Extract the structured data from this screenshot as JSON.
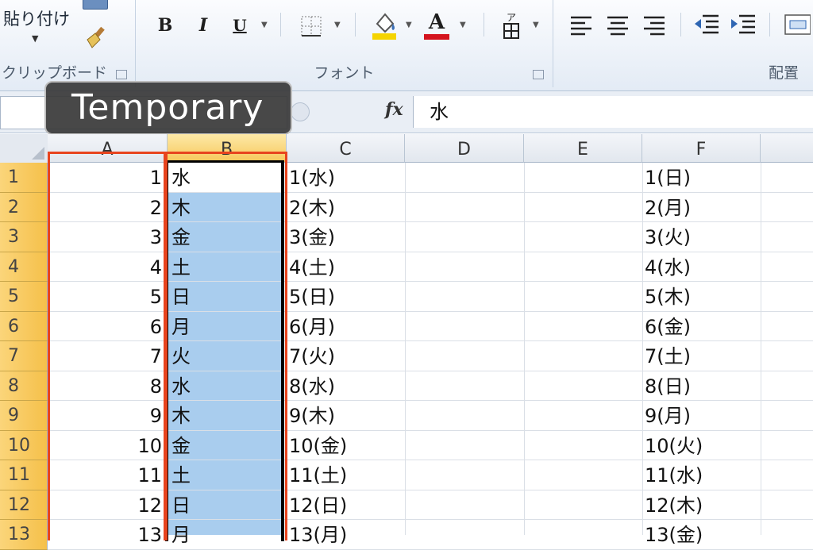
{
  "ribbon": {
    "paste_label": "貼り付け",
    "clipboard_group": "クリップボード",
    "font_group": "フォント",
    "align_group": "配置",
    "bold": "B",
    "italic": "I",
    "underline": "U",
    "font_color_letter": "A",
    "colors": {
      "highlight": "#f5d400",
      "font_color": "#d4141e"
    }
  },
  "formula_bar": {
    "fx_label": "fx",
    "value": "水"
  },
  "tooltip": {
    "text": "Temporary"
  },
  "sheet": {
    "columns": [
      "A",
      "B",
      "C",
      "D",
      "E",
      "F"
    ],
    "selected_column": "B",
    "rows": [
      {
        "n": "1",
        "a": "1",
        "b": "水",
        "c": "1(水)",
        "f": "1(日)"
      },
      {
        "n": "2",
        "a": "2",
        "b": "木",
        "c": "2(木)",
        "f": "2(月)"
      },
      {
        "n": "3",
        "a": "3",
        "b": "金",
        "c": "3(金)",
        "f": "3(火)"
      },
      {
        "n": "4",
        "a": "4",
        "b": "土",
        "c": "4(土)",
        "f": "4(水)"
      },
      {
        "n": "5",
        "a": "5",
        "b": "日",
        "c": "5(日)",
        "f": "5(木)"
      },
      {
        "n": "6",
        "a": "6",
        "b": "月",
        "c": "6(月)",
        "f": "6(金)"
      },
      {
        "n": "7",
        "a": "7",
        "b": "火",
        "c": "7(火)",
        "f": "7(土)"
      },
      {
        "n": "8",
        "a": "8",
        "b": "水",
        "c": "8(水)",
        "f": "8(日)"
      },
      {
        "n": "9",
        "a": "9",
        "b": "木",
        "c": "9(木)",
        "f": "9(月)"
      },
      {
        "n": "10",
        "a": "10",
        "b": "金",
        "c": "10(金)",
        "f": "10(火)"
      },
      {
        "n": "11",
        "a": "11",
        "b": "土",
        "c": "11(土)",
        "f": "11(水)"
      },
      {
        "n": "12",
        "a": "12",
        "b": "日",
        "c": "12(日)",
        "f": "12(木)"
      },
      {
        "n": "13",
        "a": "13",
        "b": "月",
        "c": "13(月)",
        "f": "13(金)"
      }
    ]
  }
}
